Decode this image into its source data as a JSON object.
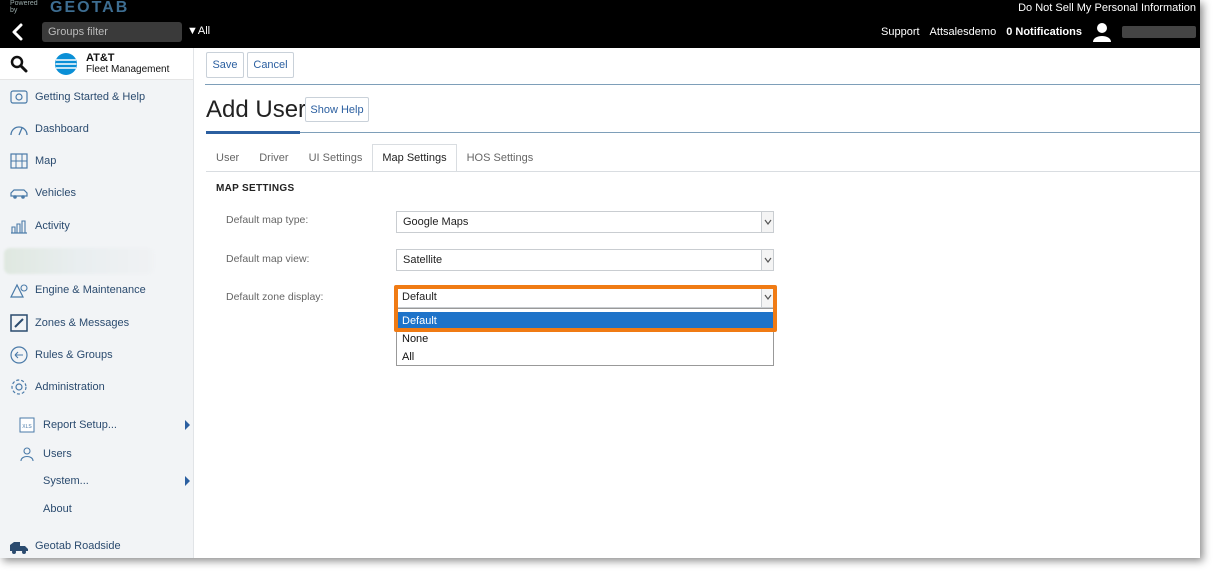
{
  "topbar": {
    "powered_by": "Powered by",
    "brand": "GEOTAB",
    "do_not_sell": "Do Not Sell My Personal Information",
    "groups_filter_placeholder": "Groups filter",
    "all_label": "All",
    "support": "Support",
    "account": "Attsalesdemo",
    "notifications": "0 Notifications"
  },
  "sidebar": {
    "logo_name": "AT&T",
    "logo_sub": "Fleet Management",
    "items": [
      {
        "label": "Getting Started & Help",
        "icon": "help-icon"
      },
      {
        "label": "Dashboard",
        "icon": "dashboard-icon"
      },
      {
        "label": "Map",
        "icon": "map-icon"
      },
      {
        "label": "Vehicles",
        "icon": "vehicle-icon"
      },
      {
        "label": "Activity",
        "icon": "activity-icon"
      },
      {
        "label": "Engine & Maintenance",
        "icon": "engine-icon"
      },
      {
        "label": "Zones & Messages",
        "icon": "zones-icon"
      },
      {
        "label": "Rules & Groups",
        "icon": "rules-icon"
      },
      {
        "label": "Administration",
        "icon": "gear-icon"
      }
    ],
    "admin_subitems": [
      {
        "label": "Report Setup...",
        "icon": "xls-icon"
      },
      {
        "label": "Users",
        "icon": "user-icon"
      },
      {
        "label": "System..."
      },
      {
        "label": "About"
      }
    ],
    "roadside": "Geotab Roadside"
  },
  "toolbar": {
    "save_label": "Save",
    "cancel_label": "Cancel"
  },
  "page": {
    "title": "Add User",
    "show_help": "Show Help"
  },
  "tabs": [
    "User",
    "Driver",
    "UI Settings",
    "Map Settings",
    "HOS Settings"
  ],
  "map_settings": {
    "section_title": "MAP SETTINGS",
    "map_type_label": "Default map type:",
    "map_type_value": "Google Maps",
    "map_view_label": "Default map view:",
    "map_view_value": "Satellite",
    "zone_display_label": "Default zone display:",
    "zone_display_value": "Default",
    "zone_options": [
      "Default",
      "None",
      "All"
    ]
  },
  "colors": {
    "accent": "#2b5fa0",
    "highlight": "#f07b14",
    "selected_option": "#1e73c9"
  }
}
